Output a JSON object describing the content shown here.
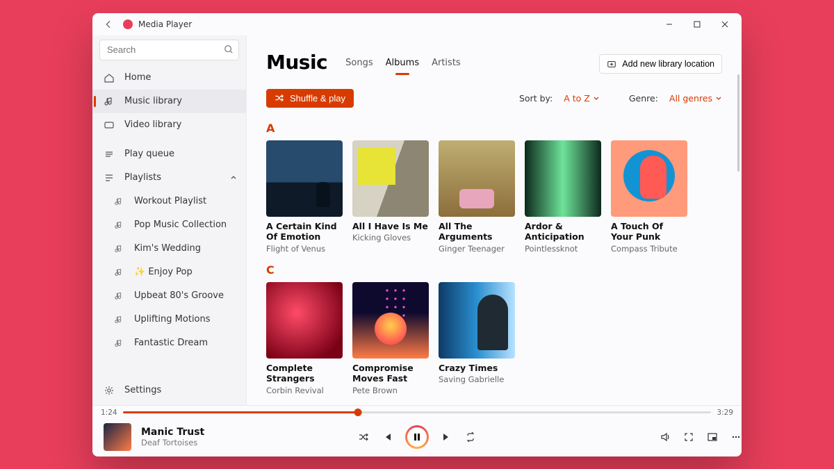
{
  "app_title": "Media Player",
  "search_placeholder": "Search",
  "sidebar": {
    "home": "Home",
    "music": "Music library",
    "video": "Video library",
    "queue": "Play queue",
    "playlists": "Playlists",
    "pl": [
      "Workout Playlist",
      "Pop Music Collection",
      "Kim's Wedding",
      "✨ Enjoy Pop",
      "Upbeat 80's Groove",
      "Uplifting Motions",
      "Fantastic Dream"
    ],
    "settings": "Settings"
  },
  "header": {
    "title": "Music",
    "tabs": [
      "Songs",
      "Albums",
      "Artists"
    ],
    "addloc": "Add new library location"
  },
  "controls": {
    "shuffle": "Shuffle & play",
    "sort_label": "Sort by:",
    "sort_value": "A to Z",
    "genre_label": "Genre:",
    "genre_value": "All genres"
  },
  "sections": [
    {
      "letter": "A",
      "albums": [
        {
          "title": "A Certain Kind Of Emotion",
          "artist": "Flight of Venus",
          "cover": "c0"
        },
        {
          "title": "All I Have Is Me",
          "artist": "Kicking Gloves",
          "cover": "c1"
        },
        {
          "title": "All The Arguments",
          "artist": "Ginger Teenager",
          "cover": "c2"
        },
        {
          "title": "Ardor & Anticipation",
          "artist": "Pointlessknot",
          "cover": "c3"
        },
        {
          "title": "A Touch Of Your Punk",
          "artist": "Compass Tribute",
          "cover": "c4"
        }
      ]
    },
    {
      "letter": "C",
      "albums": [
        {
          "title": "Complete Strangers",
          "artist": "Corbin Revival",
          "cover": "c5"
        },
        {
          "title": "Compromise Moves Fast",
          "artist": "Pete Brown",
          "cover": "c6"
        },
        {
          "title": "Crazy Times",
          "artist": "Saving Gabrielle",
          "cover": "c7"
        }
      ]
    }
  ],
  "player": {
    "elapsed": "1:24",
    "total": "3:29",
    "progress_pct": 40,
    "title": "Manic Trust",
    "artist": "Deaf Tortoises"
  }
}
